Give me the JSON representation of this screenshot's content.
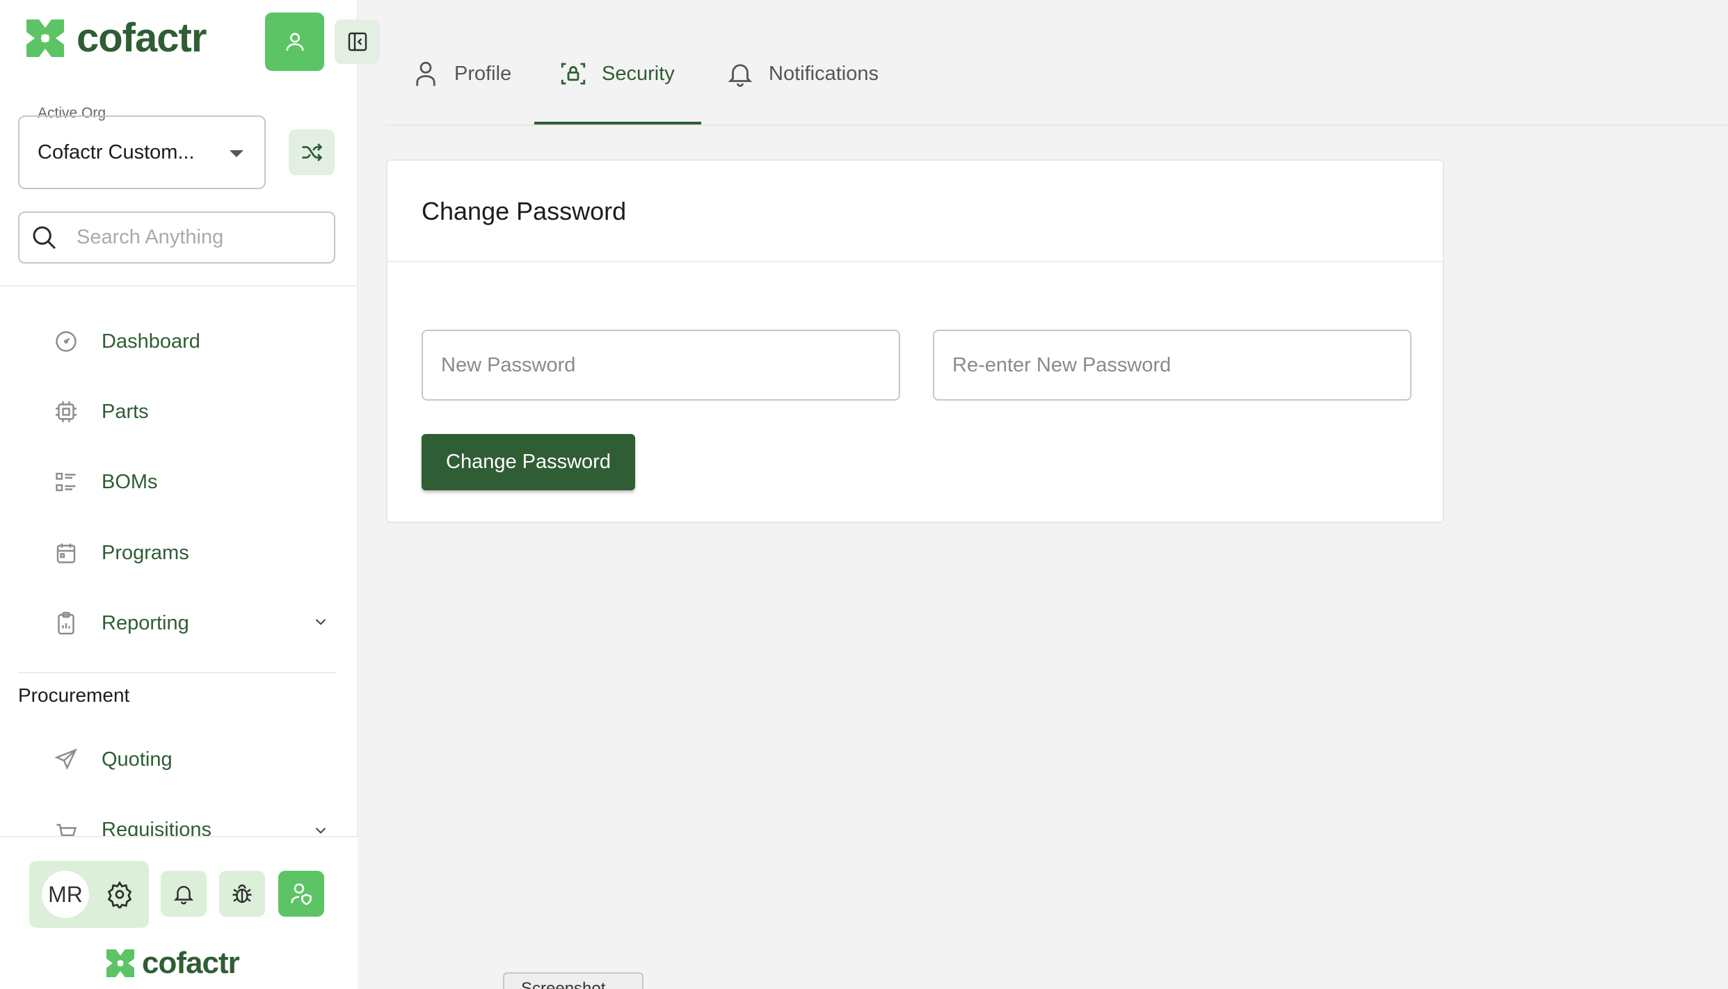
{
  "brand": {
    "name": "cofactr",
    "accent": "#5cc465",
    "dark": "#2f5d34"
  },
  "sidebar": {
    "active_org": {
      "label": "Active Org",
      "value": "Cofactr Custom..."
    },
    "search": {
      "placeholder": "Search Anything"
    },
    "items": [
      {
        "label": "Dashboard",
        "icon": "gauge-icon"
      },
      {
        "label": "Parts",
        "icon": "chip-icon"
      },
      {
        "label": "BOMs",
        "icon": "list-icon"
      },
      {
        "label": "Programs",
        "icon": "calendar-icon"
      },
      {
        "label": "Reporting",
        "icon": "clipboard-chart-icon",
        "expandable": true
      }
    ],
    "procurement": {
      "title": "Procurement",
      "items": [
        {
          "label": "Quoting",
          "icon": "send-icon"
        },
        {
          "label": "Requisitions",
          "icon": "cart-icon",
          "expandable": true
        }
      ]
    },
    "bottom": {
      "avatar_initials": "MR"
    }
  },
  "tabs": [
    {
      "label": "Profile",
      "icon": "person-icon",
      "active": false
    },
    {
      "label": "Security",
      "icon": "lock-scan-icon",
      "active": true
    },
    {
      "label": "Notifications",
      "icon": "bell-icon",
      "active": false
    }
  ],
  "card": {
    "title": "Change Password",
    "new_password_placeholder": "New Password",
    "reenter_password_placeholder": "Re-enter New Password",
    "submit_label": "Change Password"
  },
  "footer_tooltip": "Screenshot"
}
